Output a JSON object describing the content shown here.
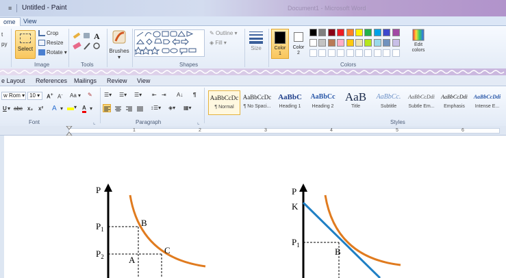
{
  "paint": {
    "quick_access": "≡",
    "title": "Untitled - Paint",
    "ghost_title": "Document1 - Microsoft Word",
    "tabs": [
      "ome",
      "View"
    ],
    "clipboard": {
      "paste_label": "py"
    },
    "image_group": {
      "label": "Image",
      "select_label": "Select",
      "crop_label": "Crop",
      "resize_label": "Resize",
      "rotate_label": "Rotate"
    },
    "tools_group": {
      "label": "Tools"
    },
    "brushes_label": "Brushes",
    "shapes_group": {
      "label": "Shapes",
      "outline_label": "Outline",
      "fill_label": "Fill"
    },
    "size_label": "Size",
    "color1_label": "Color\n1",
    "color2_label": "Color\n2",
    "colors_group": {
      "label": "Colors",
      "edit_label": "Edit\ncolors"
    },
    "palette_row1": [
      "#000000",
      "#7f7f7f",
      "#880015",
      "#ed1c24",
      "#ff7f27",
      "#fff200",
      "#22b14c",
      "#00a2e8",
      "#3f48cc",
      "#a349a4"
    ],
    "palette_row2": [
      "#ffffff",
      "#c3c3c3",
      "#b97a57",
      "#ffaec9",
      "#ffc90e",
      "#efe4b0",
      "#b5e61d",
      "#99d9ea",
      "#7092be",
      "#c8bfe7"
    ],
    "palette_row3": [
      "#ffffff",
      "#ffffff",
      "#ffffff",
      "#ffffff",
      "#ffffff",
      "#ffffff",
      "#ffffff",
      "#ffffff",
      "#ffffff",
      "#ffffff"
    ]
  },
  "word": {
    "tabs": [
      "e Layout",
      "References",
      "Mailings",
      "Review",
      "View"
    ],
    "font_name": "w Rom",
    "font_size": "10",
    "font_group_label": "Font",
    "paragraph_group_label": "Paragraph",
    "styles_group_label": "Styles",
    "styles": [
      {
        "sample": "AaBbCcDc",
        "name": "¶ Normal"
      },
      {
        "sample": "AaBbCcDc",
        "name": "¶ No Spaci..."
      },
      {
        "sample": "AaBbC",
        "name": "Heading 1"
      },
      {
        "sample": "AaBbCc",
        "name": "Heading 2"
      },
      {
        "sample": "AaB",
        "name": "Title"
      },
      {
        "sample": "AaBbCc.",
        "name": "Subtitle"
      },
      {
        "sample": "AaBbCcDdi",
        "name": "Subtle Em..."
      },
      {
        "sample": "AaBbCcDdi",
        "name": "Emphasis"
      },
      {
        "sample": "AaBbCcDdi",
        "name": "Intense E..."
      }
    ],
    "ruler_numbers": [
      "1",
      "2",
      "3",
      "4",
      "5",
      "6"
    ]
  },
  "figure_left": {
    "axis_y": "P",
    "p1": "P",
    "p1_sub": "1",
    "p2": "P",
    "p2_sub": "2",
    "point_b": "B",
    "point_c": "C",
    "point_a": "A",
    "curve_color": "#e07b1f"
  },
  "figure_right": {
    "axis_y": "P",
    "k": "K",
    "p1": "P",
    "p1_sub": "1",
    "point_b": "B",
    "curve_color": "#e07b1f",
    "line_color": "#1f7fc4"
  }
}
